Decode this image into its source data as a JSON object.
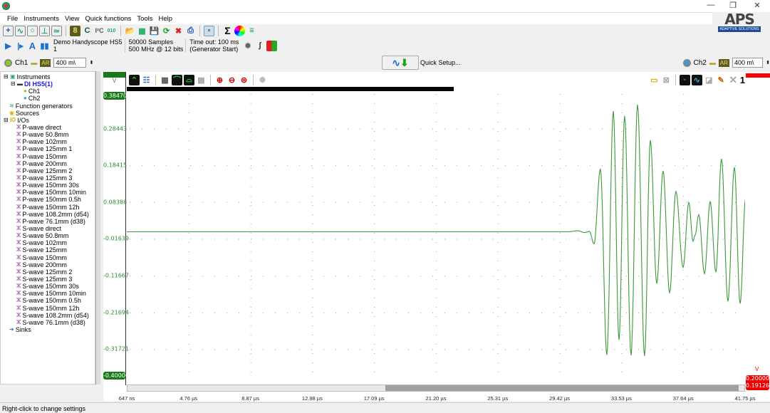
{
  "window": {
    "minimize": "—",
    "maximize": "❐",
    "close": "✕"
  },
  "menu": [
    "File",
    "Instruments",
    "View",
    "Quick functions",
    "Tools",
    "Help"
  ],
  "logo": {
    "text": "APS",
    "tagline": "ADAPTIVE SOLUTIONS"
  },
  "instrument": {
    "name": "Demo Handyscope HS5",
    "index": "1",
    "samples": "50000 Samples",
    "rate": "500 MHz @ 12 bits",
    "timeout": "Time out: 100 ms",
    "trigger": "(Generator Start)"
  },
  "ch1": {
    "label": "Ch1",
    "ar": "AR",
    "range": "400 m\\"
  },
  "ch2": {
    "label": "Ch2",
    "ar": "AR",
    "range": "400 m\\"
  },
  "quick_setup": "Quick Setup...",
  "plot_toolbar": {
    "channel_number": "1"
  },
  "tree": {
    "instruments": "Instruments",
    "device": "DI HS5(1)",
    "ch1": "Ch1",
    "ch2": "Ch2",
    "function_generators": "Function generators",
    "sources": "Sources",
    "ios": "I/Os",
    "sinks": "Sinks",
    "io_items": [
      "P-wave direct",
      "P-wave 50.8mm",
      "P-wave 102mm",
      "P-wave 125mm 1",
      "P-wave 150mm",
      "P-wave 200mm",
      "P-wave 125mm 2",
      "P-wave 125mm 3",
      "P-wave 150mm 30s",
      "P-wave 150mm 10min",
      "P-wave 150mm 0.5h",
      "P-wave 150mm 12h",
      "P-wave 108.2mm  (d54)",
      "P-wave 76.1mm  (d38)",
      "S-wave direct",
      "S-wave 50.8mm",
      "S-wave 102mm",
      "S-wave 125mm",
      "S-wave 150mm",
      "S-wave 200mm",
      "S-wave 125mm 2",
      "S-wave 125mm 3",
      "S-wave 150mm 30s",
      "S-wave 150mm 10min",
      "S-wave 150mm 0.5h",
      "S-wave 150mm 12h",
      "S-wave 108.2mm  (d54)",
      "S-wave 76.1mm  (d38)"
    ]
  },
  "status": "Right-click to change settings",
  "chart_data": {
    "type": "line",
    "ylabel": "V",
    "ylim": [
      -0.4,
      0.3847
    ],
    "xlim_us": [
      0.647,
      41.75
    ],
    "y_ticks": [
      "0.38470",
      "0.28443",
      "0.18415",
      "0.08388",
      "-0.01639",
      "-0.11667",
      "-0.21694",
      "-0.31721",
      "-0.40000"
    ],
    "x_ticks": [
      "647 ns",
      "4.76 µs",
      "8.87 µs",
      "12.98 µs",
      "17.09 µs",
      "21.20 µs",
      "25.31 µs",
      "29.42 µs",
      "33.53 µs",
      "37.64 µs",
      "41.75 µs"
    ],
    "ch2_unit": "V",
    "ch2_top": "0.20000",
    "ch2_bottom": "0.19126",
    "series": [
      {
        "color": "#3a9a3a",
        "x_us": [
          0.647,
          30.0,
          30.6,
          31.1,
          31.4,
          31.71,
          32.13,
          32.56,
          32.99,
          33.37,
          33.74,
          34.17,
          34.6,
          35.07,
          35.45,
          35.88,
          36.3,
          36.73,
          37.15,
          37.63,
          38.01,
          38.29,
          38.43,
          38.67,
          39.05,
          39.43,
          39.81,
          40.18,
          40.61,
          41.04,
          41.42,
          41.79
        ],
        "y": [
          0.003,
          0.003,
          0.006,
          0.001,
          0.004,
          -0.03,
          0.175,
          -0.333,
          0.332,
          -0.292,
          0.319,
          -0.334,
          0.35,
          -0.336,
          0.253,
          -0.138,
          0.169,
          -0.164,
          0.113,
          -0.094,
          0.083,
          -0.023,
          -0.006,
          0.05,
          -0.111,
          0.085,
          -0.107,
          0.202,
          -0.187,
          0.179,
          -0.193,
          0.097
        ]
      }
    ]
  }
}
